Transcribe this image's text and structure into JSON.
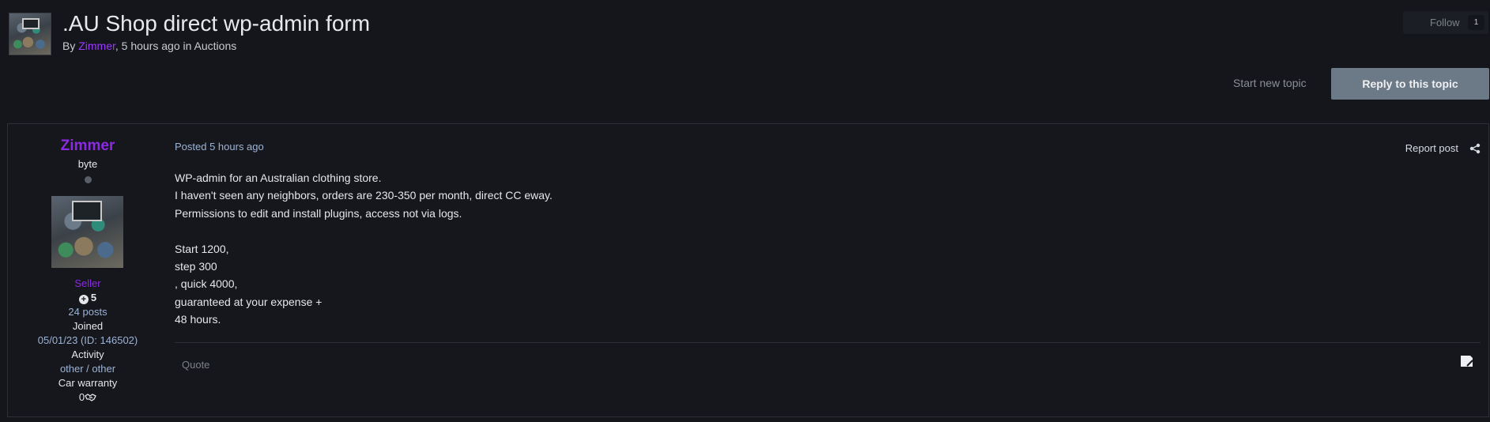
{
  "topic": {
    "title": ".AU Shop direct wp-admin form",
    "meta_by": "By ",
    "author": "Zimmer",
    "meta_rest": ", 5 hours ago in Auctions"
  },
  "follow": {
    "label": "Follow",
    "count": "1"
  },
  "actions": {
    "start_new_topic": "Start new topic",
    "reply": "Reply to this topic"
  },
  "post": {
    "author": {
      "name": "Zimmer",
      "rank": "byte",
      "group": "Seller",
      "reputation": "5",
      "posts": "24 posts",
      "joined_label": "Joined",
      "joined_value": "05/01/23 (ID: 146502)",
      "activity_label": "Activity",
      "activity_value": "other / other",
      "warranty_label": "Car warranty",
      "warranty_value": "0"
    },
    "posted": "Posted 5 hours ago",
    "report": "Report post",
    "lines": [
      "WP-admin for an Australian clothing store.",
      "I haven't seen any neighbors, orders are 230-350 per month, direct CC eway.",
      "Permissions to edit and install plugins, access not via logs.",
      "",
      "Start 1200,",
      "step 300",
      ", quick 4000,",
      "guaranteed at your expense +",
      "48 hours."
    ],
    "quote": "Quote"
  },
  "colors": {
    "accent": "#8a2be2",
    "reply_button": "#6c7986",
    "link": "#9db3d6",
    "background": "#14161b"
  },
  "icons": [
    "share-icon",
    "flag-icon",
    "handshake-icon",
    "plus-circle-icon"
  ]
}
